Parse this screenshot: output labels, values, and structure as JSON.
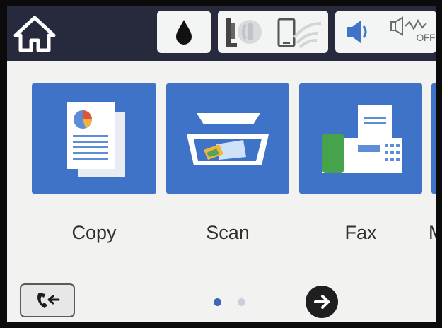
{
  "status_bar": {
    "home_icon": "home-icon",
    "ink_icon": "ink-drop-icon",
    "network_icons": [
      "wired-phone-icon",
      "wifi-tablet-icon"
    ],
    "sound_icon": "speaker-icon",
    "fax_off_label": "OFF"
  },
  "apps": [
    {
      "label": "Copy",
      "icon": "copy-document-icon"
    },
    {
      "label": "Scan",
      "icon": "scanner-icon"
    },
    {
      "label": "Fax",
      "icon": "fax-machine-icon"
    },
    {
      "label": "M",
      "icon": "next-app-partial"
    }
  ],
  "bottom_bar": {
    "job_button_icon": "job-status-icon",
    "page_count": 2,
    "current_page": 1,
    "next_icon": "arrow-right-icon"
  },
  "colors": {
    "topbar": "#27293d",
    "tile_blue": "#3f73c8",
    "screen_bg": "#f2f3f1"
  }
}
